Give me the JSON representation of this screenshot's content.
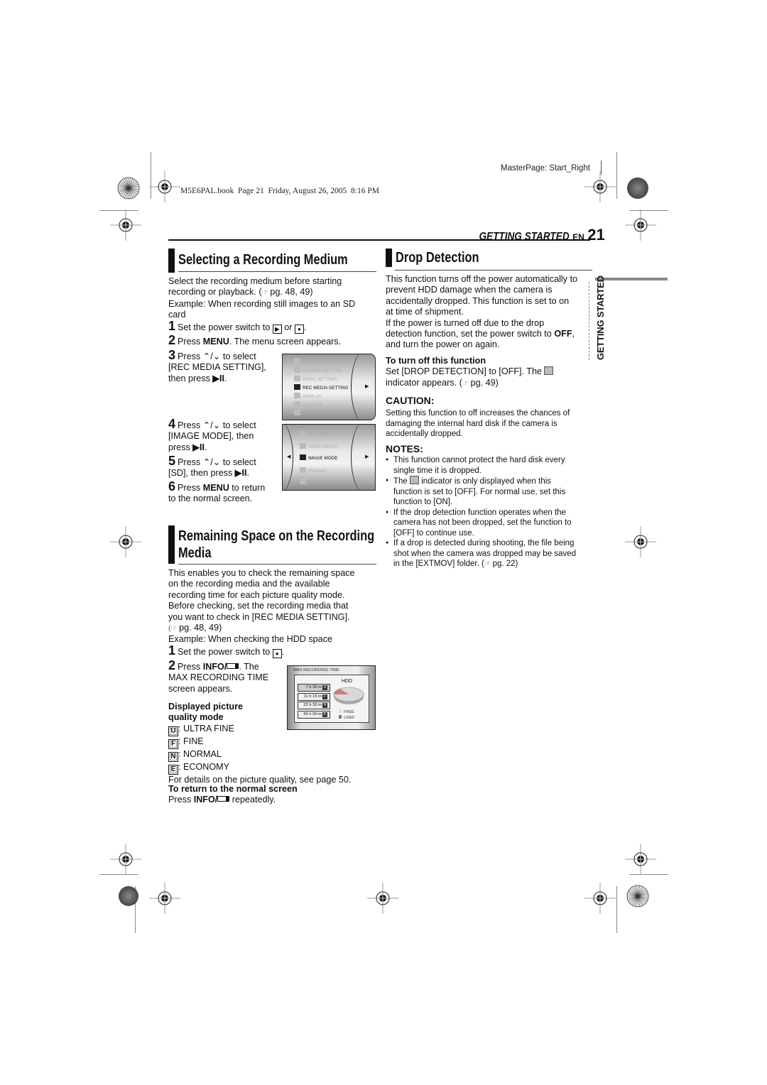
{
  "header": {
    "masterpage": "MasterPage: Start_Right",
    "book_info": "M5E6PAL.book  Page 21  Friday, August 26, 2005  8:16 PM",
    "section_label": "GETTING STARTED",
    "lang": "EN",
    "page_number": "21",
    "side_tab": "GETTING STARTED"
  },
  "selecting": {
    "title": "Selecting a Recording Medium",
    "intro1": "Select the recording medium before starting",
    "intro2_pre": "recording or playback. (",
    "intro2_ref": "pg. 48, 49)",
    "example1": "Example: When recording still images to an SD",
    "example2": "card",
    "steps": [
      {
        "num": "1",
        "text_pre": "Set the power switch to ",
        "text_mid": " or ",
        "text_post": "."
      },
      {
        "num": "2",
        "text_pre": "Press ",
        "bold": "MENU",
        "text_post": ". The menu screen appears."
      },
      {
        "num": "3",
        "l1_pre": "Press ",
        "l1_post": " to select",
        "l2": "[REC MEDIA SETTING],",
        "l3_pre": "then press ",
        "l3_post": "."
      },
      {
        "num": "4",
        "l1_pre": "Press ",
        "l1_post": " to select",
        "l2": "[IMAGE MODE], then",
        "l3_pre": "press ",
        "l3_post": "."
      },
      {
        "num": "5",
        "l1_pre": "Press ",
        "l1_post": " to select",
        "l2_pre": "[SD], then press ",
        "l2_post": "."
      },
      {
        "num": "6",
        "l1_pre": "Press ",
        "bold": "MENU",
        "l1_post": " to return",
        "l2": "to the normal screen."
      }
    ],
    "menu_screen": {
      "items": [
        {
          "label": "DIS",
          "selected": false
        },
        {
          "label": "CAMERA SETTING",
          "selected": false
        },
        {
          "label": "BASIC SETTING",
          "selected": false
        },
        {
          "label": "REC MEDIA SETTING",
          "selected": true
        },
        {
          "label": "DISPLAY",
          "selected": false
        },
        {
          "label": "QUALITY",
          "selected": false
        },
        {
          "label": "WIDE MODE",
          "selected": false
        }
      ]
    },
    "submenu_screen": {
      "items": [
        {
          "label": "NO. RESET",
          "selected": false
        },
        {
          "label": "VIDEO MODE",
          "selected": false
        },
        {
          "label": "IMAGE MODE",
          "selected": true
        },
        {
          "label": "FORMAT",
          "selected": false
        },
        {
          "label": "CLEAN UP",
          "selected": false
        }
      ]
    }
  },
  "remaining": {
    "title_l1": "Remaining Space on the Recording",
    "title_l2": "Media",
    "para": [
      "This enables you to check the remaining space",
      "on the recording media and the available",
      "recording time for each picture quality mode.",
      "Before checking, set the recording media that",
      "you want to check in [REC MEDIA SETTING]."
    ],
    "ref": "pg. 48, 49)",
    "example": "Example: When checking the HDD space",
    "step1": {
      "num": "1",
      "pre": "Set the power switch to ",
      "post": "."
    },
    "step2": {
      "num": "2",
      "pre": "Press ",
      "bold": "INFO/",
      "post": ". The",
      "l2": "MAX RECORDING TIME",
      "l3": "screen appears."
    },
    "displayed_heading_l1": "Displayed picture",
    "displayed_heading_l2": "quality mode",
    "modes": [
      {
        "icon": "U",
        "label": ": ULTRA FINE"
      },
      {
        "icon": "F",
        "label": ": FINE"
      },
      {
        "icon": "N",
        "label": ": NORMAL"
      },
      {
        "icon": "E",
        "label": ": ECONOMY"
      }
    ],
    "details": "For details on the picture quality, see page 50.",
    "return_heading": "To return to the normal screen",
    "return_pre": "Press ",
    "return_bold": "INFO/",
    "return_post": " repeatedly.",
    "max_screen": {
      "title": "MAX RECORDING TIME",
      "media": "HDD",
      "rows": [
        {
          "time": "7 h 30 m",
          "mode": "U"
        },
        {
          "time": "11 h 15 m",
          "mode": "F"
        },
        {
          "time": "22 h 30 m",
          "mode": "N"
        },
        {
          "time": "45 h 00 m",
          "mode": "E"
        }
      ],
      "legend_free": "FREE",
      "legend_used": "USED",
      "used_fraction": 0.15
    }
  },
  "drop": {
    "title": "Drop Detection",
    "para": [
      "This function turns off the power automatically to",
      "prevent HDD damage when the camera is",
      "accidentally dropped. This function is set to on",
      "at time of shipment.",
      "If the power is turned off due to the drop"
    ],
    "para_l6_pre": "detection function, set the power switch to ",
    "para_l6_bold": "OFF",
    "para_l6_post": ",",
    "para_l7": "and turn the power on again.",
    "turnoff_heading": "To turn off this function",
    "turnoff_l1": "Set [DROP DETECTION] to [OFF]. The ",
    "turnoff_l2_pre": "indicator appears. (",
    "turnoff_l2_ref": "pg. 49)",
    "caution_heading": "CAUTION:",
    "caution": [
      "Setting this function to off increases the chances of",
      "damaging the internal hard disk if the camera is",
      "accidentally dropped."
    ],
    "notes_heading": "NOTES:",
    "notes": [
      [
        "This function cannot protect the hard disk every",
        "single time it is dropped."
      ],
      [
        "The ",
        " indicator is only displayed when this",
        "function is set to [OFF]. For normal use, set this",
        "function to [ON]."
      ],
      [
        "If the drop detection function operates when the",
        "camera has not been dropped, set the function to",
        "[OFF] to continue use."
      ],
      [
        "If a drop is detected during shooting, the file being",
        "shot when the camera was dropped may be saved",
        "in the [EXTMOV] folder. (",
        "pg. 22)"
      ]
    ]
  }
}
